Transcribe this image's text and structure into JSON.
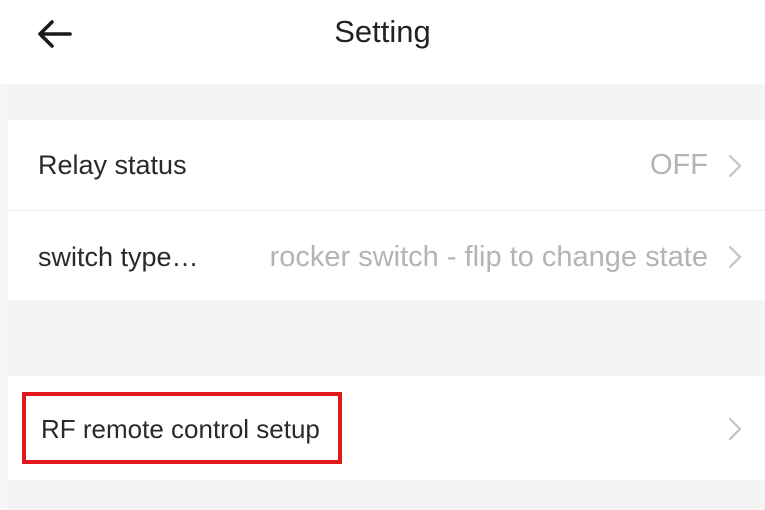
{
  "header": {
    "title": "Setting",
    "back_icon": "arrow-left-icon"
  },
  "rows": [
    {
      "label": "Relay status",
      "value": "OFF",
      "icon": "chevron-right-icon"
    },
    {
      "label": "switch type…",
      "value": "rocker switch - flip to change state",
      "icon": "chevron-right-icon"
    },
    {
      "label": "RF remote control setup",
      "value": "",
      "icon": "chevron-right-icon"
    }
  ],
  "colors": {
    "background": "#f6f6f6",
    "row_background": "#ffffff",
    "label_text": "#2a2a2a",
    "value_text": "#b4b4b4",
    "highlight": "#e0191f"
  }
}
